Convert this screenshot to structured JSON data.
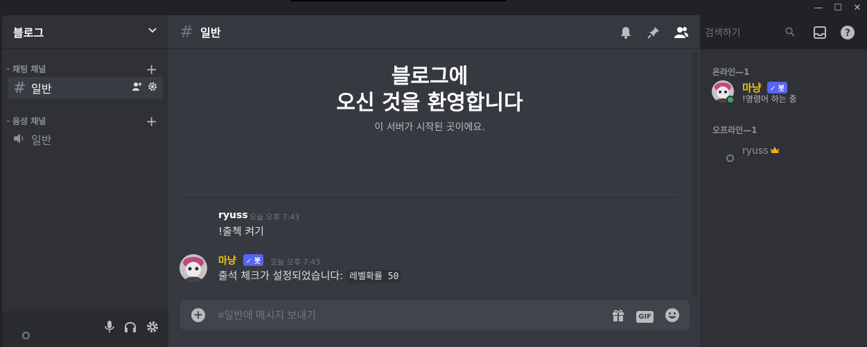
{
  "server": {
    "name": "블로그"
  },
  "categories": [
    {
      "label": "채팅 채널",
      "channels": [
        {
          "name": "일반",
          "type": "text",
          "active": true
        }
      ]
    },
    {
      "label": "음성 채널",
      "channels": [
        {
          "name": "일반",
          "type": "voice",
          "active": false
        }
      ]
    }
  ],
  "chat": {
    "channel_name": "일반",
    "welcome_line1": "블로그에",
    "welcome_line2": "오신 것을 환영합니다",
    "welcome_sub": "이 서버가 시작된 곳이에요.",
    "messages": [
      {
        "author": "ryuss",
        "time": "오늘 오후 7:43",
        "text": "!출첵 켜기",
        "bot": false
      },
      {
        "author": "마냥",
        "badge": "✓ 봇",
        "time": "오늘 오후 7:43",
        "text": "출석 체크가 설정되었습니다:",
        "code": "레벨확률 50",
        "bot": true
      }
    ],
    "composer_placeholder": "#일반에 메시지 보내기"
  },
  "toolbar": {
    "search_placeholder": "검색하기"
  },
  "members": {
    "online_label": "온라인—1",
    "offline_label": "오프라인—1",
    "online": [
      {
        "name": "마냥",
        "badge": "✓ 봇",
        "status": "!명령어 하는 중"
      }
    ],
    "offline": [
      {
        "name": "ryuss"
      }
    ]
  },
  "composer_icons": {
    "gif_label": "GIF"
  },
  "colors": {
    "accent": "#5865f2",
    "bot_name": "#f1c40f",
    "online": "#3ba55d",
    "crown": "#faa81a"
  }
}
